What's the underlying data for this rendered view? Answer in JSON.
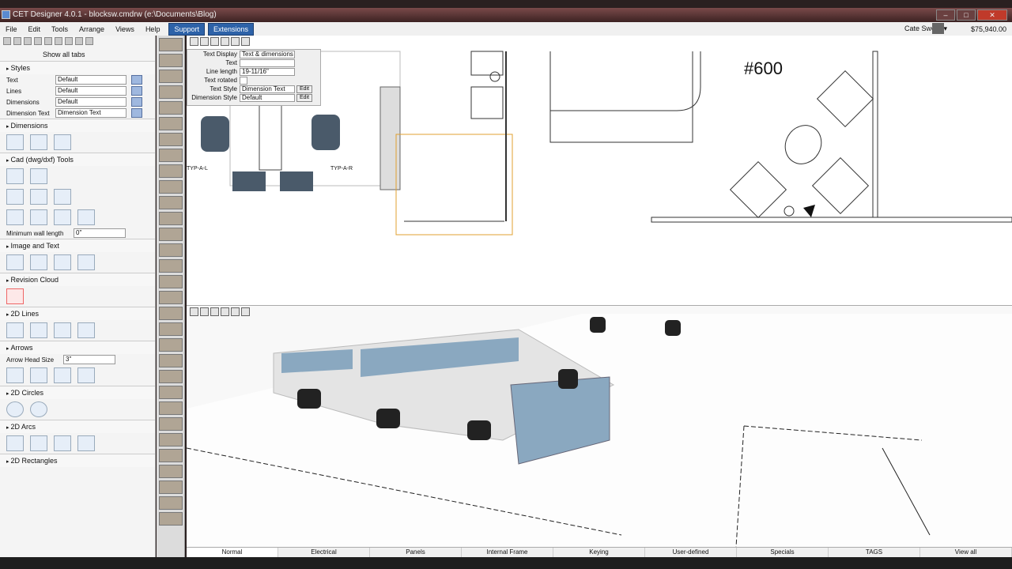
{
  "window": {
    "title": "CET Designer 4.0.1 - blocksw.cmdrw (e:\\Documents\\Blog)"
  },
  "menu": {
    "items": [
      "File",
      "Edit",
      "Tools",
      "Arrange",
      "Views",
      "Help"
    ],
    "support": "Support",
    "extensions": "Extensions",
    "user": "Cate Sword ▾",
    "amount": "$75,940.00"
  },
  "left": {
    "show_all": "Show all tabs",
    "styles": {
      "title": "Styles",
      "rows": [
        {
          "label": "Text",
          "value": "Default"
        },
        {
          "label": "Lines",
          "value": "Default"
        },
        {
          "label": "Dimensions",
          "value": "Default"
        },
        {
          "label": "Dimension Text",
          "value": "Dimension Text"
        }
      ]
    },
    "dimensions": "Dimensions",
    "cad": "Cad (dwg/dxf) Tools",
    "min_wall": {
      "label": "Minimum wall length",
      "value": "0\""
    },
    "image_text": "Image and Text",
    "revision": "Revision Cloud",
    "lines2d": "2D Lines",
    "arrows": "Arrows",
    "arrow_head": {
      "label": "Arrow Head Size",
      "value": "3\""
    },
    "circles": "2D Circles",
    "arcs": "2D Arcs",
    "rects": "2D Rectangles"
  },
  "props": {
    "rows": [
      {
        "label": "Text Display",
        "value": "Text & dimensions"
      },
      {
        "label": "Text",
        "value": ""
      },
      {
        "label": "Line length",
        "value": "19-11/16\""
      },
      {
        "label": "Text rotated",
        "value": ""
      },
      {
        "label": "Text Style",
        "value": "Dimension Text"
      },
      {
        "label": "Dimension Style",
        "value": "Default"
      }
    ],
    "edit": "Edit"
  },
  "plan": {
    "room_label": "#600",
    "typ_l": "TYP-A-L",
    "typ_r": "TYP-A-R"
  },
  "tabs": [
    "Normal",
    "Electrical",
    "Panels",
    "Internal Frame",
    "Keying",
    "User-defined",
    "Specials",
    "TAGS",
    "View all"
  ]
}
